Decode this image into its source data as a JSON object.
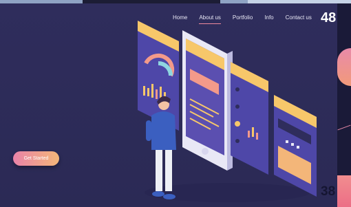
{
  "nav": {
    "items": [
      "Home",
      "About us",
      "Portfolio",
      "Info",
      "Contact us"
    ],
    "active": "About us"
  },
  "page_number_top": "48",
  "page_number_bottom": "38",
  "cta_label": "Get Started",
  "colors": {
    "background": "#2c2b56",
    "accent_pink": "#e983a8",
    "accent_orange": "#f3b679",
    "card_yellow": "#f7c76a",
    "card_purple": "#5b4fb0"
  }
}
